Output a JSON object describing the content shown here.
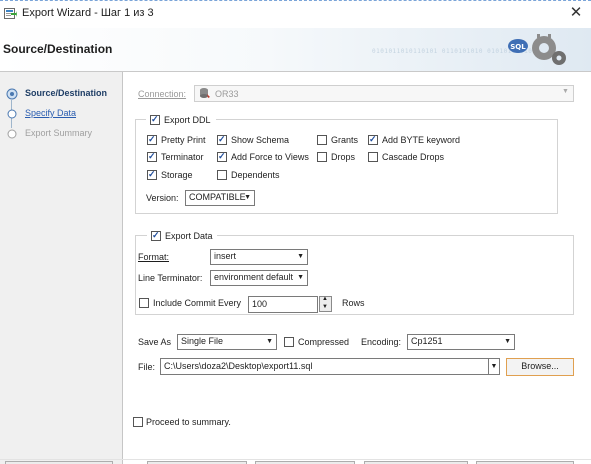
{
  "window": {
    "title": "Export Wizard - Шаг 1 из 3",
    "close_glyph": "✕"
  },
  "header": {
    "title": "Source/Destination",
    "decor_bits": "0101011010110101 0110101010 01010101010"
  },
  "nav": {
    "items": [
      {
        "label": "Source/Destination",
        "state": "current"
      },
      {
        "label": "Specify Data",
        "state": "link"
      },
      {
        "label": "Export Summary",
        "state": "disabled"
      }
    ]
  },
  "connection": {
    "label": "Connection:",
    "value": "OR33"
  },
  "ddl": {
    "enabled": true,
    "label": "Export DDL",
    "options": [
      {
        "label": "Pretty Print",
        "checked": true
      },
      {
        "label": "Show Schema",
        "checked": true
      },
      {
        "label": "Grants",
        "checked": false
      },
      {
        "label": "Add BYTE keyword",
        "checked": true
      },
      {
        "label": "Terminator",
        "checked": true
      },
      {
        "label": "Add Force to Views",
        "checked": true
      },
      {
        "label": "Drops",
        "checked": false
      },
      {
        "label": "Cascade Drops",
        "checked": false
      },
      {
        "label": "Storage",
        "checked": true
      },
      {
        "label": "Dependents",
        "checked": false
      }
    ],
    "version_label": "Version:",
    "version_value": "COMPATIBLE"
  },
  "data": {
    "enabled": true,
    "label": "Export Data",
    "format_label": "Format:",
    "format_value": "insert",
    "terminator_label": "Line Terminator:",
    "terminator_value": "environment default",
    "commit_label": "Include Commit Every",
    "commit_checked": false,
    "commit_value": "100",
    "rows_label": "Rows"
  },
  "output": {
    "save_as_label": "Save As",
    "save_as_value": "Single File",
    "compressed_label": "Compressed",
    "compressed_checked": false,
    "encoding_label": "Encoding:",
    "encoding_value": "Cp1251",
    "file_label": "File:",
    "file_value": "C:\\Users\\doza2\\Desktop\\export11.sql",
    "browse_label": "Browse..."
  },
  "proceed": {
    "label": "Proceed to summary.",
    "checked": false
  },
  "colors": {
    "nav_bg": "#f0f0f0",
    "link_blue": "#2a5db0",
    "check_blue": "#1f4d9c",
    "browse_border": "#e0a050"
  },
  "icons": {
    "app": "export-wizard-icon",
    "connection": "database-connection-icon",
    "header": "sql-gears-icon"
  }
}
